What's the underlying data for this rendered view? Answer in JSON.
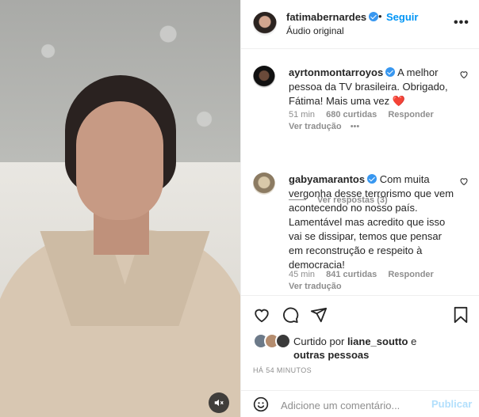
{
  "post": {
    "username": "fatimabernardes",
    "follow_label": "Seguir",
    "audio_label": "Áudio original",
    "more_label": "•••"
  },
  "comments": [
    {
      "username": "ayrtonmontarroyos",
      "text": "A melhor pessoa da TV brasileira. Obrigado, Fátima! Mais uma vez",
      "emoji": "❤️",
      "time": "51 min",
      "likes": "680 curtidas",
      "reply_label": "Responder",
      "translate_label": "Ver tradução",
      "options_label": "•••",
      "replies_label": "Ver respostas (3)"
    },
    {
      "username": "gabyamarantos",
      "text": "Com muita vergonha desse terrorismo que vem acontecendo no nosso país. Lamentável mas acredito que isso vai se dissipar, temos que pensar em reconstrução e respeito à democracia!",
      "time": "45 min",
      "likes": "841 curtidas",
      "reply_label": "Responder",
      "translate_label": "Ver tradução"
    }
  ],
  "likes": {
    "prefix": "Curtido por",
    "user": "liane_soutto",
    "conjunction": "e",
    "others": "outras pessoas"
  },
  "timestamp": "HÁ 54 MINUTOS",
  "composer": {
    "placeholder": "Adicione um comentário...",
    "publish_label": "Publicar"
  },
  "icons": {
    "like": "heart-icon",
    "comment": "comment-icon",
    "share": "paper-plane-icon",
    "save": "bookmark-icon",
    "emoji": "smiley-icon",
    "mute": "speaker-muted-icon"
  },
  "colors": {
    "link_blue": "#0095f6",
    "verified_blue": "#3897f0",
    "muted_text": "#8e8e8e",
    "publish_disabled": "#b2dffc"
  }
}
